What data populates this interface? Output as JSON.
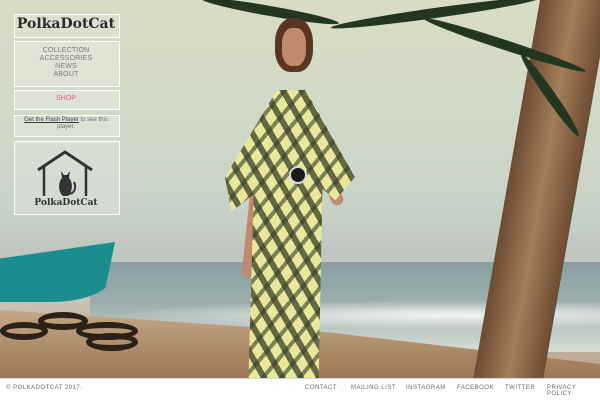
{
  "brand": {
    "logo": "PolkaDotCat",
    "emblem_label": "PolkaDotCat"
  },
  "nav": {
    "items": [
      "COLLECTION",
      "ACCESSORIES",
      "NEWS",
      "ABOUT"
    ],
    "shop": "SHOP"
  },
  "flash": {
    "link": "Get the Flash Player",
    "rest": "to see this player."
  },
  "footer": {
    "copyright": "© POLKADOTCAT 2017.",
    "links": [
      "CONTACT",
      "MAILING LIST",
      "INSTAGRAM",
      "FACEBOOK",
      "TWITTER",
      "PRIVACY POLICY"
    ]
  },
  "colors": {
    "shop": "#e35a7a",
    "boat": "#1c8d8e",
    "dress": "#e8e79a"
  }
}
